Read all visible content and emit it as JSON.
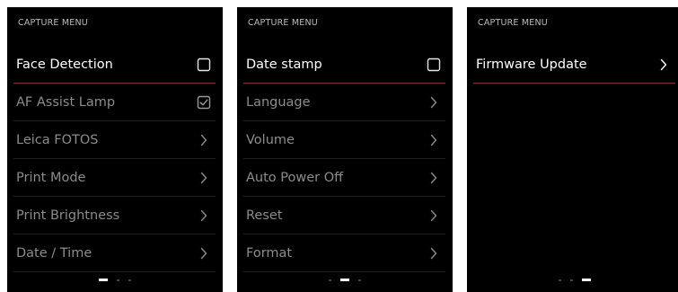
{
  "screens": [
    {
      "header": "CAPTURE MENU",
      "items": [
        {
          "label": "Face Detection",
          "control": "checkbox",
          "checked": false,
          "active": true
        },
        {
          "label": "AF Assist Lamp",
          "control": "checkbox",
          "checked": true,
          "active": false
        },
        {
          "label": "Leica FOTOS",
          "control": "chevron",
          "active": false
        },
        {
          "label": "Print Mode",
          "control": "chevron",
          "active": false
        },
        {
          "label": "Print Brightness",
          "control": "chevron",
          "active": false
        },
        {
          "label": "Date / Time",
          "control": "chevron",
          "active": false
        }
      ],
      "page_index": 0,
      "page_count": 3
    },
    {
      "header": "CAPTURE MENU",
      "items": [
        {
          "label": "Date stamp",
          "control": "checkbox",
          "checked": false,
          "active": true
        },
        {
          "label": "Language",
          "control": "chevron",
          "active": false
        },
        {
          "label": "Volume",
          "control": "chevron",
          "active": false
        },
        {
          "label": "Auto Power Off",
          "control": "chevron",
          "active": false
        },
        {
          "label": "Reset",
          "control": "chevron",
          "active": false
        },
        {
          "label": "Format",
          "control": "chevron",
          "active": false
        }
      ],
      "page_index": 1,
      "page_count": 3
    },
    {
      "header": "CAPTURE MENU",
      "items": [
        {
          "label": "Firmware Update",
          "control": "chevron",
          "active": true
        }
      ],
      "page_index": 2,
      "page_count": 3
    }
  ],
  "colors": {
    "background": "#000000",
    "accent": "#c8102e",
    "text_active": "#ffffff",
    "text_inactive": "#8c8c8c",
    "header_text": "#bdbdbd"
  }
}
